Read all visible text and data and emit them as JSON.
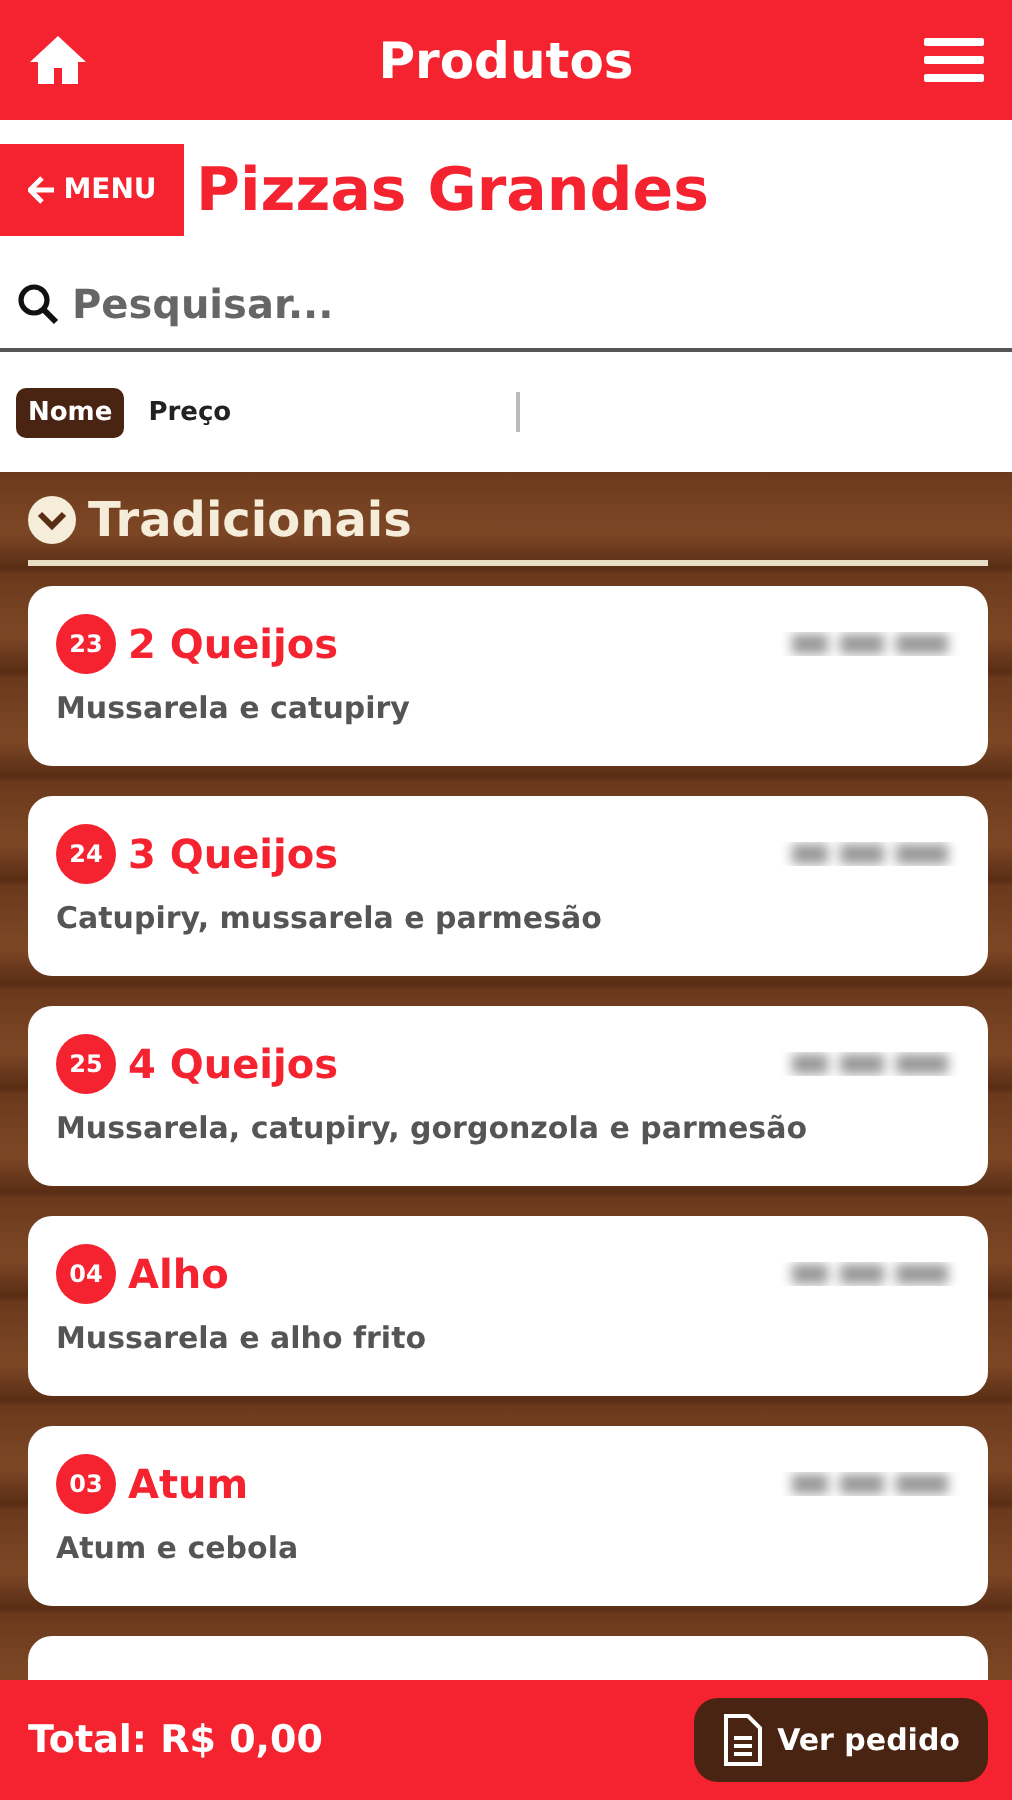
{
  "header": {
    "title": "Produtos"
  },
  "back_button": {
    "label": "MENU"
  },
  "page_title": "Pizzas Grandes",
  "search": {
    "placeholder": "Pesquisar..."
  },
  "sort_options": [
    {
      "label": "Nome",
      "selected": true
    },
    {
      "label": "Preço",
      "selected": false
    }
  ],
  "category": {
    "title": "Tradicionais",
    "expanded": true
  },
  "products": [
    {
      "code": "23",
      "name": "2 Queijos",
      "description": "Mussarela e catupiry"
    },
    {
      "code": "24",
      "name": "3 Queijos",
      "description": "Catupiry, mussarela e parmesão"
    },
    {
      "code": "25",
      "name": "4 Queijos",
      "description": "Mussarela, catupiry, gorgonzola e parmesão"
    },
    {
      "code": "04",
      "name": "Alho",
      "description": "Mussarela e alho frito"
    },
    {
      "code": "03",
      "name": "Atum",
      "description": "Atum e cebola"
    }
  ],
  "footer": {
    "total": "Total: R$ 0,00",
    "order_button": "Ver pedido"
  }
}
